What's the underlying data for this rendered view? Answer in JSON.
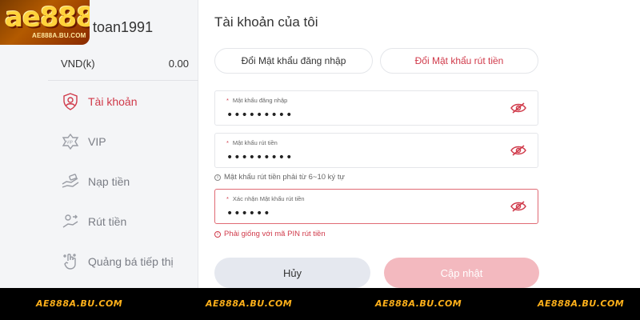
{
  "logo": {
    "main": "ae888",
    "sub": "AE888A.BU.COM"
  },
  "user": {
    "username": "toan1991",
    "currency": "VND(k)",
    "balance": "0.00"
  },
  "sidebar": {
    "items": [
      {
        "label": "Tài khoản",
        "icon": "user-shield-icon",
        "active": true
      },
      {
        "label": "VIP",
        "icon": "vip-badge-icon",
        "active": false
      },
      {
        "label": "Nạp tiền",
        "icon": "deposit-hand-icon",
        "active": false
      },
      {
        "label": "Rút tiền",
        "icon": "withdraw-icon",
        "active": false
      },
      {
        "label": "Quảng bá tiếp thị",
        "icon": "promotion-icon",
        "active": false
      }
    ]
  },
  "main": {
    "title": "Tài khoản của tôi",
    "tabs": [
      {
        "label": "Đổi Mật khẩu đăng nhập",
        "active": false
      },
      {
        "label": "Đổi Mật khẩu rút tiền",
        "active": true
      }
    ],
    "fields": [
      {
        "label": "Mật khẩu đăng nhập",
        "value": "•••••••••"
      },
      {
        "label": "Mật khẩu rút tiền",
        "value": "•••••••••"
      },
      {
        "label": "Xác nhận Mật khẩu rút tiền",
        "value": "••••••"
      }
    ],
    "hint_withdraw": "Mật khẩu rút tiền phải từ 6~10 ký tự",
    "error_confirm": "Phải giống với mã PIN rút tiền",
    "cancel_label": "Hủy",
    "update_label": "Cập nhật"
  },
  "footer": {
    "watermarks": [
      "AE888A.BU.COM",
      "AE888A.BU.COM",
      "AE888A.BU.COM",
      "AE888A.BU.COM"
    ]
  },
  "colors": {
    "accent": "#d03a4a",
    "update_button": "#f3b9bf",
    "cancel_button": "#e5e8ef",
    "sidebar_bg": "#f4f5f7",
    "footer_bg": "#000000",
    "watermark": "#ffb11a"
  }
}
